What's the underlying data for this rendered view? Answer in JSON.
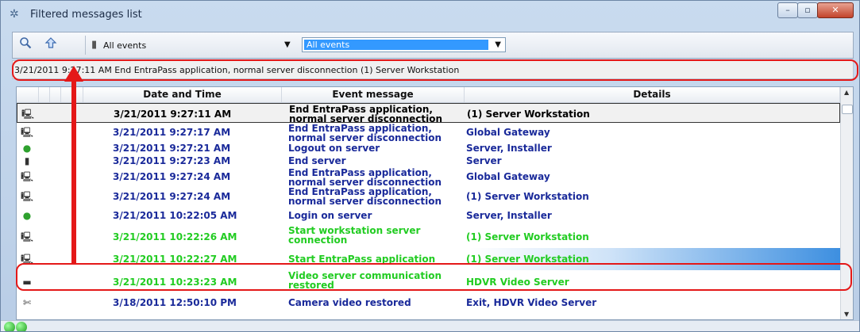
{
  "window": {
    "title": "Filtered messages list",
    "controls": {
      "minimize": "–",
      "maximize": "▫",
      "close": "✕"
    }
  },
  "toolbar": {
    "search_icon": "magnifier-icon",
    "up_icon": "arrow-up-icon",
    "filter_label": "All events",
    "combo_value": "All events"
  },
  "selected_info": {
    "text": "3/21/2011 9:27:11 AM  End EntraPass application, normal server disconnection  (1) Server Workstation"
  },
  "grid": {
    "columns": [
      "Date and Time",
      "Event message",
      "Details"
    ],
    "rows": [
      {
        "icon": "workstation-icon",
        "date": "3/21/2011 9:27:11 AM",
        "message": "End EntraPass application, normal server disconnection",
        "details": "(1) Server Workstation",
        "color": "#000000"
      },
      {
        "icon": "workstation-icon",
        "date": "3/21/2011 9:27:17 AM",
        "message": "End EntraPass application, normal server disconnection",
        "details": "Global Gateway",
        "color": "#1a2a9a"
      },
      {
        "icon": "green-dot-icon",
        "date": "3/21/2011 9:27:21 AM",
        "message": "Logout on server",
        "details": "Server, Installer",
        "color": "#1a2a9a"
      },
      {
        "icon": "server-icon",
        "date": "3/21/2011 9:27:23 AM",
        "message": "End server",
        "details": "Server",
        "color": "#1a2a9a"
      },
      {
        "icon": "workstation-icon",
        "date": "3/21/2011 9:27:24 AM",
        "message": "End EntraPass application, normal server disconnection",
        "details": "Global Gateway",
        "color": "#1a2a9a"
      },
      {
        "icon": "workstation-icon",
        "date": "3/21/2011 9:27:24 AM",
        "message": "End EntraPass application, normal server disconnection",
        "details": "(1) Server Workstation",
        "color": "#1a2a9a"
      },
      {
        "icon": "green-dot-icon",
        "date": "3/21/2011 10:22:05 AM",
        "message": "Login on server",
        "details": "Server, Installer",
        "color": "#1a2a9a"
      },
      {
        "icon": "workstation-icon",
        "date": "3/21/2011 10:22:26 AM",
        "message": "Start workstation server connection",
        "details": "(1) Server Workstation",
        "color": "#22cc22"
      },
      {
        "icon": "workstation-icon",
        "date": "3/21/2011 10:22:27 AM",
        "message": "Start EntraPass application",
        "details": "(1) Server Workstation",
        "color": "#22cc22"
      },
      {
        "icon": "video-server-icon",
        "date": "3/21/2011 10:23:23 AM",
        "message": "Video server communication restored",
        "details": "HDVR Video Server",
        "color": "#22cc22"
      },
      {
        "icon": "camera-icon",
        "date": "3/18/2011 12:50:10 PM",
        "message": "Camera video restored",
        "details": "Exit, HDVR Video Server",
        "color": "#1a2a9a"
      }
    ]
  },
  "status": {
    "icon1": "green-status-icon",
    "icon2": "green-status-icon"
  }
}
